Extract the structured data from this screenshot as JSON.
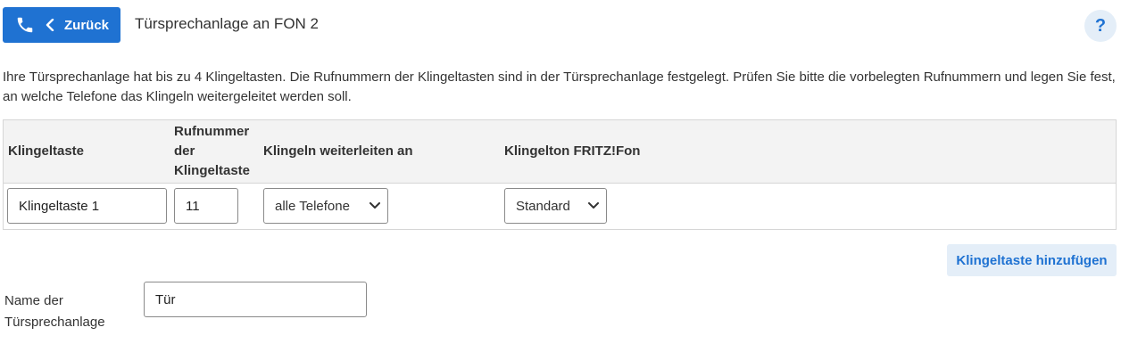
{
  "header": {
    "back_label": "Zurück",
    "title": "Türsprechanlage an FON 2",
    "help_label": "?",
    "phone_icon": "phone-icon",
    "back_icon": "chevron-left-icon"
  },
  "intro": "Ihre Türsprechanlage hat bis zu 4 Klingeltasten. Die Rufnummern der Klingeltasten sind in der Türsprechanlage festgelegt. Prüfen Sie bitte die vorbelegten Rufnummern und legen Sie fest, an welche Telefone das Klingeln weitergeleitet werden soll.",
  "table": {
    "headers": {
      "klingeltaste": "Klingeltaste",
      "rufnummer_line1": "Rufnummer",
      "rufnummer_line2": "der",
      "rufnummer_line3": "Klingeltaste",
      "weiterleiten": "Klingeln weiterleiten an",
      "klingelton": "Klingelton FRITZ!Fon"
    },
    "rows": [
      {
        "name": "Klingeltaste 1",
        "number": "11",
        "forward": "alle Telefone",
        "ringtone": "Standard"
      }
    ]
  },
  "add_button": "Klingeltaste hinzufügen",
  "name_field": {
    "label_line1": "Name der",
    "label_line2": "Türsprechanlage",
    "value": "Tür"
  },
  "colors": {
    "primary": "#1f72d2",
    "light_accent": "#e4eef8",
    "header_bg": "#f3f3f3"
  }
}
